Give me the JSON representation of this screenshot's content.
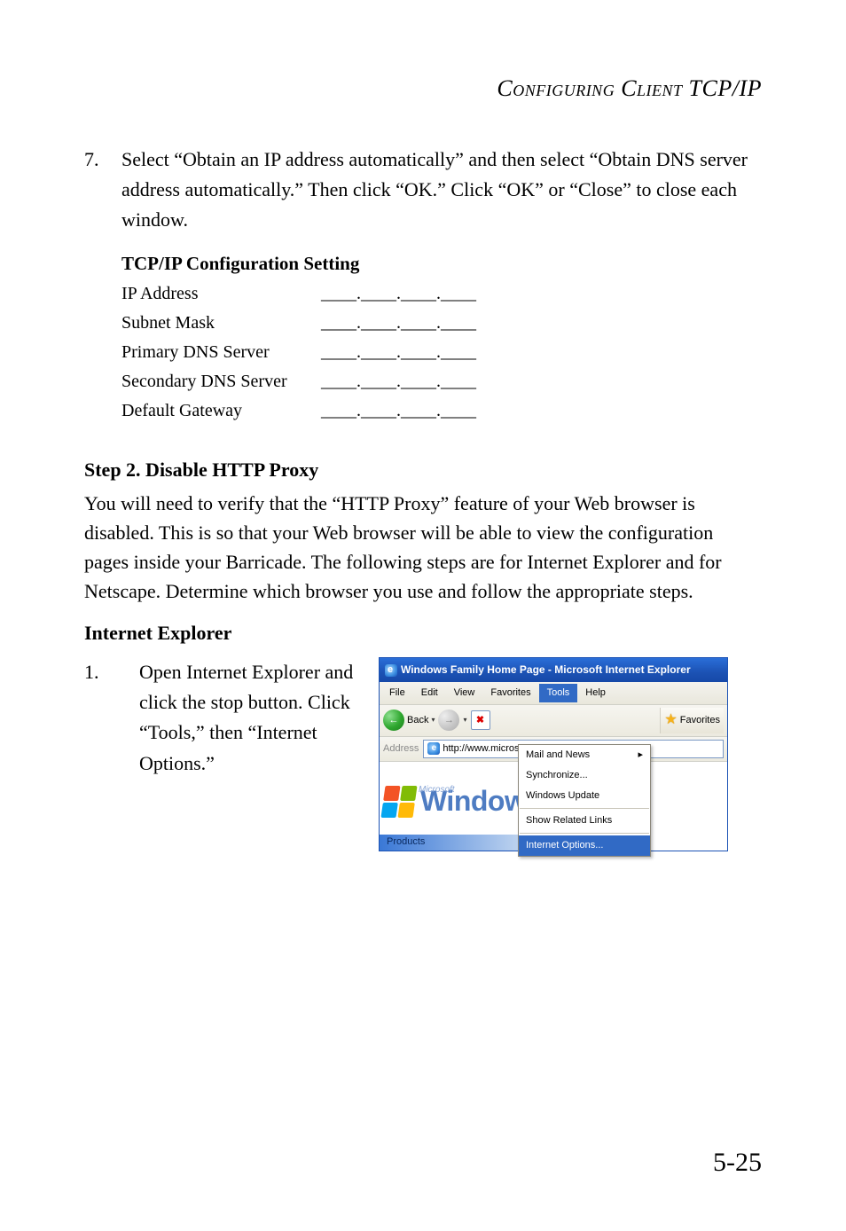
{
  "running_head": "Configuring Client TCP/IP",
  "step7": {
    "num": "7.",
    "text": "Select “Obtain an IP address automatically” and then select “Obtain DNS server address automatically.” Then click “OK.” Click “OK” or “Close” to close each window."
  },
  "table": {
    "heading": "TCP/IP Configuration Setting",
    "rows": [
      {
        "label": "IP Address",
        "blank": "____.____.____.____"
      },
      {
        "label": "Subnet Mask",
        "blank": "____.____.____.____"
      },
      {
        "label": "Primary DNS Server",
        "blank": "____.____.____.____"
      },
      {
        "label": "Secondary DNS Server",
        "blank": "____.____.____.____"
      },
      {
        "label": "Default Gateway",
        "blank": "____.____.____.____"
      }
    ]
  },
  "step2_heading": "Step 2. Disable HTTP Proxy",
  "step2_para": "You will need to verify that the “HTTP Proxy” feature of your Web browser is disabled. This is so that your Web browser will be able to view the configuration pages inside your Barricade. The following steps are for Internet Explorer and for Netscape. Determine which browser you use and follow the appropriate steps.",
  "ie_heading": "Internet Explorer",
  "step1": {
    "num": "1.",
    "text": "Open Internet Explorer and click the stop button. Click “Tools,” then “Internet Options.”"
  },
  "ie_window": {
    "title": "Windows Family Home Page - Microsoft Internet Explorer",
    "menu": {
      "file": "File",
      "edit": "Edit",
      "view": "View",
      "favorites": "Favorites",
      "tools": "Tools",
      "help": "Help"
    },
    "toolbar": {
      "back": "Back",
      "favorites_btn": "Favorites"
    },
    "dropdown": {
      "mail": "Mail and News",
      "sync": "Synchronize...",
      "update": "Windows Update",
      "related": "Show Related Links",
      "internet_options": "Internet Options..."
    },
    "address_label": "Address",
    "address_value": "http://www.microso",
    "ms_label": "Microsoft",
    "windows_label": "Windows",
    "products_tab": "Products"
  },
  "page_number": "5-25"
}
